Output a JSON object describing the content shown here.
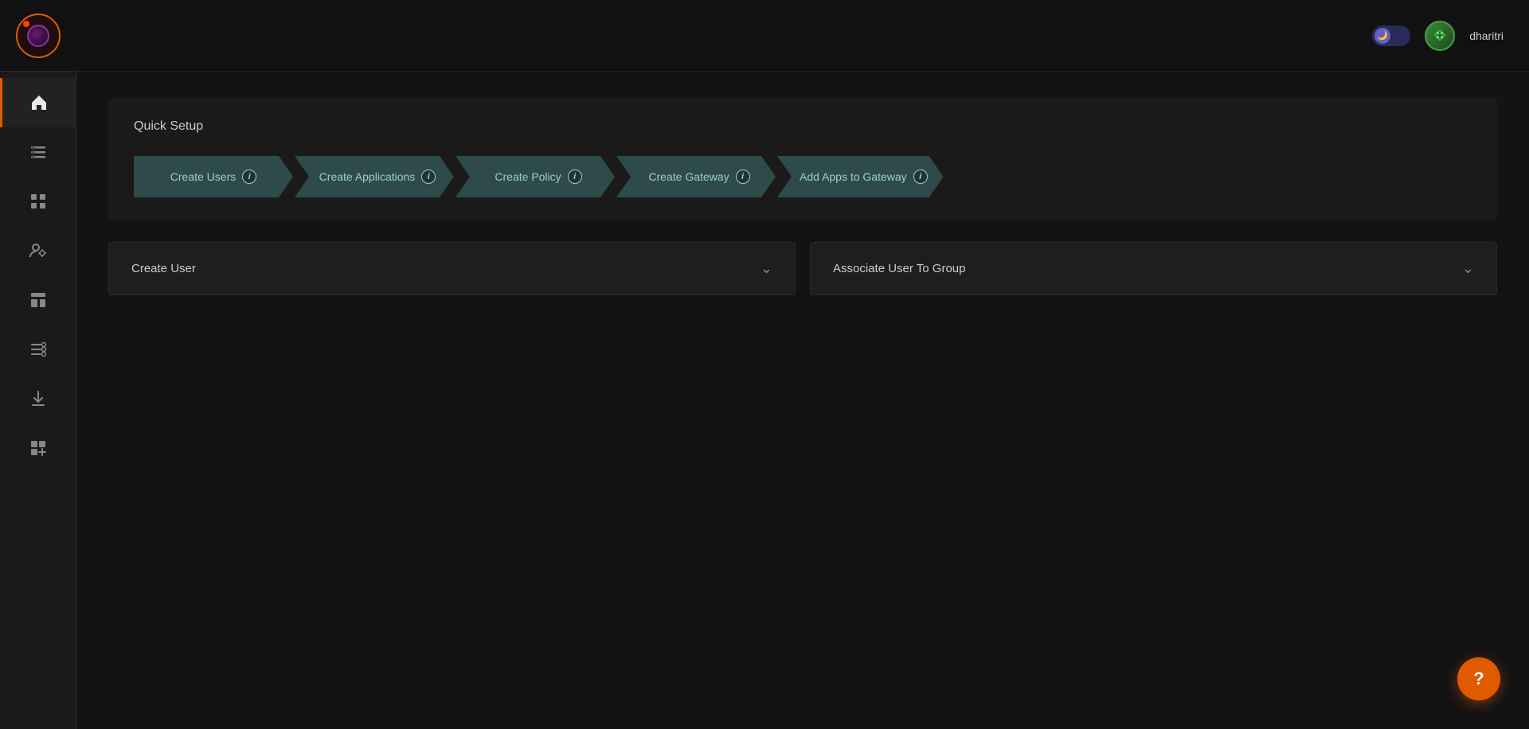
{
  "app": {
    "title": "Quick Setup"
  },
  "topbar": {
    "username": "dharitri",
    "toggle_label": "dark mode toggle"
  },
  "sidebar": {
    "items": [
      {
        "id": "home",
        "icon": "home",
        "label": "Home",
        "active": true
      },
      {
        "id": "users",
        "icon": "users",
        "label": "Users",
        "active": false
      },
      {
        "id": "grid",
        "icon": "grid",
        "label": "Grid",
        "active": false
      },
      {
        "id": "admin",
        "icon": "admin",
        "label": "Admin",
        "active": false
      },
      {
        "id": "layout",
        "icon": "layout",
        "label": "Layout",
        "active": false
      },
      {
        "id": "settings-list",
        "icon": "settings-list",
        "label": "Settings List",
        "active": false
      },
      {
        "id": "download",
        "icon": "download",
        "label": "Download",
        "active": false
      },
      {
        "id": "add-module",
        "icon": "add-module",
        "label": "Add Module",
        "active": false
      }
    ]
  },
  "quick_setup": {
    "title": "Quick Setup",
    "steps": [
      {
        "id": "create-users",
        "label": "Create Users",
        "info": "i"
      },
      {
        "id": "create-applications",
        "label": "Create Applications",
        "info": "i"
      },
      {
        "id": "create-policy",
        "label": "Create Policy",
        "info": "i"
      },
      {
        "id": "create-gateway",
        "label": "Create Gateway",
        "info": "i"
      },
      {
        "id": "add-apps-to-gateway",
        "label": "Add Apps to Gateway",
        "info": "i"
      }
    ]
  },
  "cards": [
    {
      "id": "create-user",
      "title": "Create User"
    },
    {
      "id": "associate-user-to-group",
      "title": "Associate User To Group"
    }
  ],
  "help": {
    "label": "?"
  }
}
